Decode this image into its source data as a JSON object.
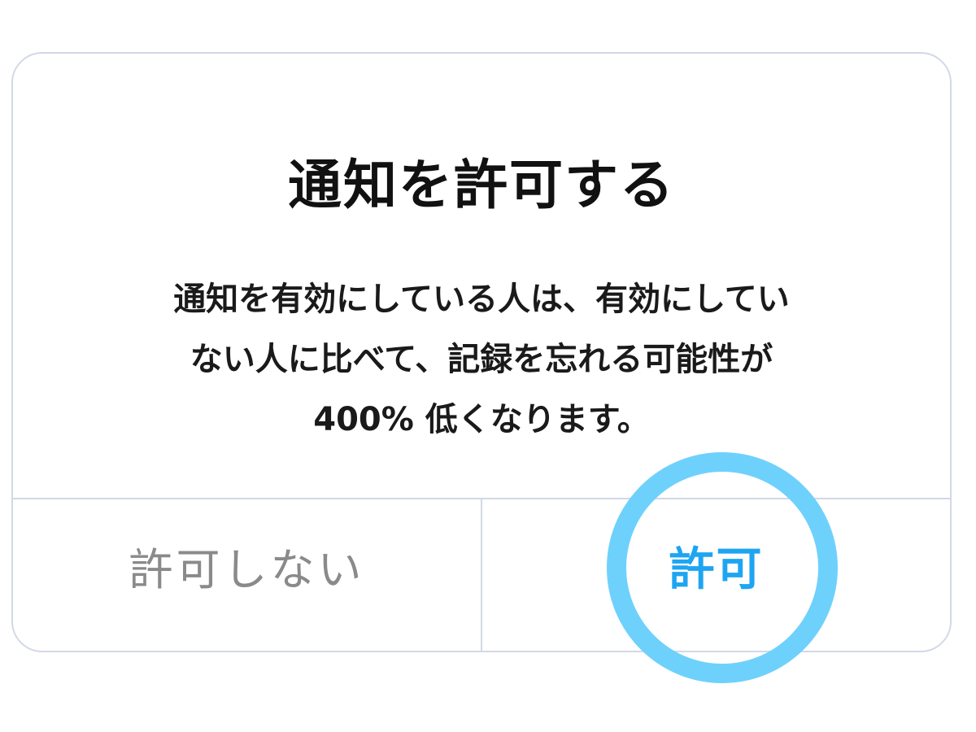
{
  "dialog": {
    "title": "通知を許可する",
    "message_lines": [
      "通知を有効にしている人は、有効にしてい",
      "ない人に比べて、記録を忘れる可能性が",
      "400% 低くなります。"
    ],
    "deny_label": "許可しない",
    "allow_label": "許可"
  },
  "colors": {
    "allow_text": "#1ea5f2",
    "highlight_ring": "#6ed1fc",
    "deny_text": "#8a8a8a",
    "border": "#d3d8e6"
  }
}
